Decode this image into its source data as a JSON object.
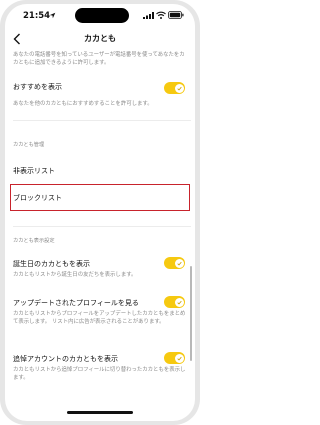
{
  "status_bar": {
    "time": "21:54"
  },
  "nav": {
    "title": "カカとも"
  },
  "top_description": "あなたの電話番号を知っているユーザーが電話番号を使ってあなたをカカともに追加できるように許可します。",
  "recommend": {
    "title": "おすすめを表示",
    "description": "あなたを他のカカともにおすすめすることを許可します。",
    "enabled": true
  },
  "manage_section": {
    "header": "カカとも管理",
    "hidden_list": "非表示リスト",
    "block_list": "ブロックリスト"
  },
  "display_section": {
    "header": "カカとも表示設定",
    "items": [
      {
        "title": "誕生日のカカともを表示",
        "description": "カカともリストから誕生日の友だちを表示します。",
        "enabled": true
      },
      {
        "title": "アップデートされたプロフィールを見る",
        "description": "カカともリストからプロフィールをアップデートしたカカともをまとめて表示します。 リスト内に広告が表示されることがあります。",
        "enabled": true
      },
      {
        "title": "追悼アカウントのカカともを表示",
        "description": "カカともリストから追悼プロフィールに切り替わったカカともを表示します。",
        "enabled": true
      }
    ]
  },
  "colors": {
    "accent": "#f6c910",
    "highlight": "#c8232c"
  }
}
